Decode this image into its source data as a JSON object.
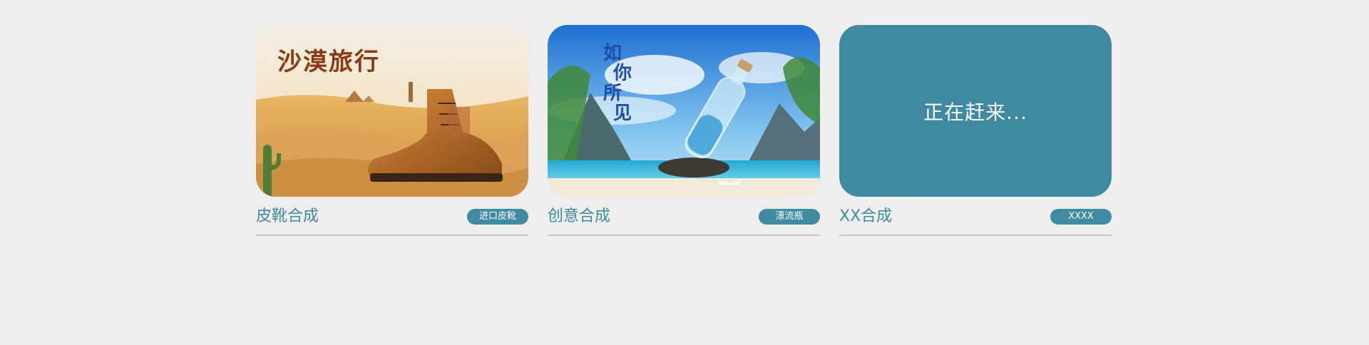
{
  "cards": [
    {
      "title": "皮靴合成",
      "tag": "进口皮靴",
      "poster_text": "沙漠旅行",
      "image": "desert-boot-image"
    },
    {
      "title": "创意合成",
      "tag": "漂流瓶",
      "poster_text_lines": [
        "如",
        "你",
        "所",
        "见"
      ],
      "image": "bottle-island-image"
    },
    {
      "title": "XX合成",
      "tag": "XXXX",
      "placeholder_text": "正在赶来..."
    }
  ],
  "colors": {
    "background": "#eeeeee",
    "accent": "#3f8aa0",
    "divider": "#c8c8c8"
  }
}
